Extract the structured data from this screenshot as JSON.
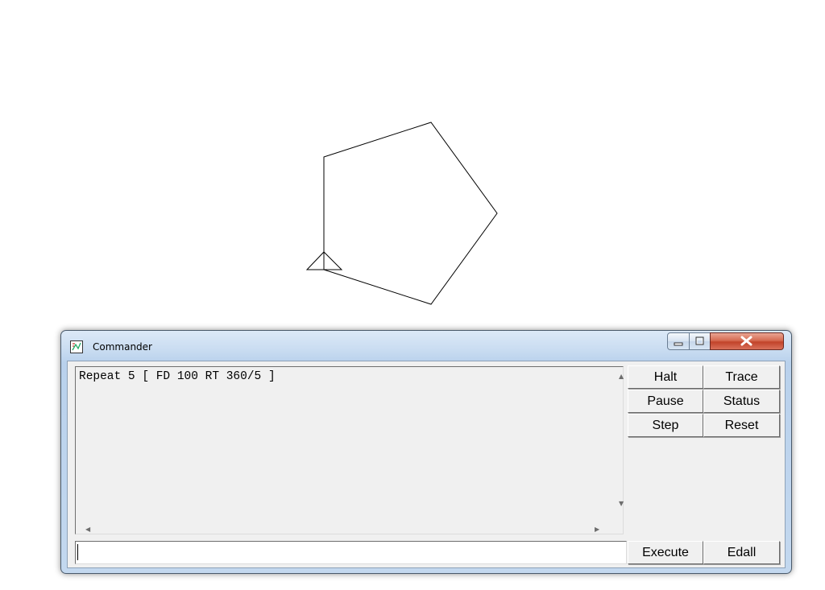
{
  "window": {
    "title": "Commander"
  },
  "history": {
    "lines": [
      "Repeat 5 [ FD 100 RT 360/5 ]"
    ]
  },
  "buttons": {
    "halt": "Halt",
    "trace": "Trace",
    "pause": "Pause",
    "status": "Status",
    "step": "Step",
    "reset": "Reset",
    "execute": "Execute",
    "edall": "Edall"
  },
  "input": {
    "value": "",
    "placeholder": ""
  },
  "colors": {
    "drawing_line": "#000000",
    "close_button": "#c2432a",
    "titlebar": "#c9dcf1"
  },
  "icons": {
    "title": "logo-app-icon",
    "minimize": "minimize-icon",
    "maximize": "maximize-icon",
    "close": "close-icon",
    "turtle": "turtle-icon"
  }
}
